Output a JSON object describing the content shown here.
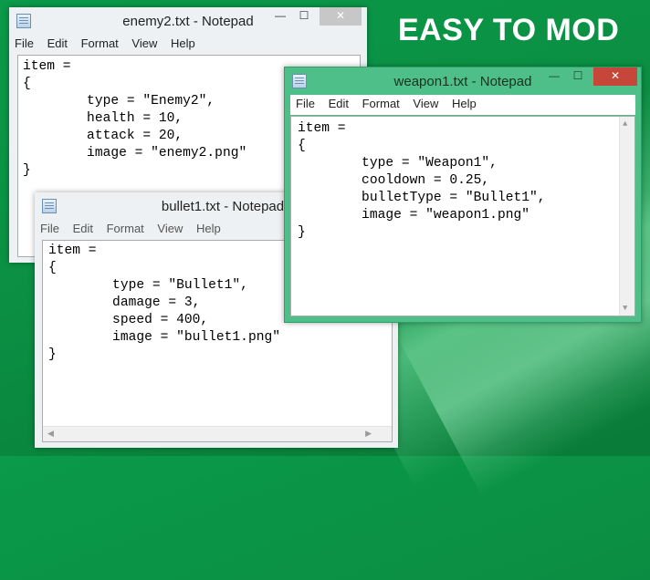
{
  "headline": "EASY TO MOD",
  "menu": [
    "File",
    "Edit",
    "Format",
    "View",
    "Help"
  ],
  "window_controls": {
    "minimize": "—",
    "maximize": "☐",
    "close": "✕"
  },
  "windows": {
    "enemy2": {
      "title": "enemy2.txt - Notepad",
      "lines": [
        "item =",
        "{",
        "        type = \"Enemy2\",",
        "        health = 10,",
        "        attack = 20,",
        "        image = \"enemy2.png\"",
        "}"
      ]
    },
    "bullet1": {
      "title": "bullet1.txt - Notepad",
      "lines": [
        "item =",
        "{",
        "        type = \"Bullet1\",",
        "        damage = 3,",
        "        speed = 400,",
        "        image = \"bullet1.png\"",
        "}"
      ]
    },
    "weapon1": {
      "title": "weapon1.txt - Notepad",
      "lines": [
        "item =",
        "{",
        "        type = \"Weapon1\",",
        "        cooldown = 0.25,",
        "        bulletType = \"Bullet1\",",
        "        image = \"weapon1.png\"",
        "}"
      ]
    }
  },
  "colors": {
    "background": "#0a9a49",
    "active_frame": "#4fbf8a",
    "inactive_frame": "#e8ecef",
    "close_button": "#c7463a"
  }
}
